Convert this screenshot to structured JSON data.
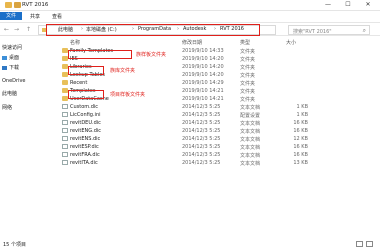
{
  "window": {
    "title": "RVT 2016",
    "minimize": "—",
    "maximize": "☐",
    "close": "✕"
  },
  "ribbon": {
    "tabs": [
      "文件",
      "共享",
      "查看"
    ]
  },
  "nav": {
    "back": "←",
    "forward": "→",
    "up": "↑"
  },
  "breadcrumb": [
    "此电脑",
    "本地磁盘 (C:)",
    "ProgramData",
    "Autodesk",
    "RVT 2016"
  ],
  "search": {
    "placeholder": "搜索\"RVT 2016\""
  },
  "sidebar": [
    "快速访问",
    "桌面",
    "下载",
    "OneDrive",
    "此电脑",
    "网络"
  ],
  "columns": {
    "name": "名称",
    "date": "修改日期",
    "type": "类型",
    "size": "大小"
  },
  "files": [
    {
      "name": "Family Templates",
      "date": "2019/9/10 14:33",
      "type": "文件夹",
      "size": "",
      "kind": "folder"
    },
    {
      "name": "IES",
      "date": "2019/9/10 14:20",
      "type": "文件夹",
      "size": "",
      "kind": "folder"
    },
    {
      "name": "Libraries",
      "date": "2019/9/10 14:20",
      "type": "文件夹",
      "size": "",
      "kind": "folder"
    },
    {
      "name": "Lookup Tables",
      "date": "2019/9/10 14:20",
      "type": "文件夹",
      "size": "",
      "kind": "folder"
    },
    {
      "name": "Recent",
      "date": "2019/9/10 14:29",
      "type": "文件夹",
      "size": "",
      "kind": "folder"
    },
    {
      "name": "Templates",
      "date": "2019/9/10 14:21",
      "type": "文件夹",
      "size": "",
      "kind": "folder"
    },
    {
      "name": "UserDataCache",
      "date": "2019/9/10 14:21",
      "type": "文件夹",
      "size": "",
      "kind": "folder"
    },
    {
      "name": "Custom.dic",
      "date": "2014/12/3 5:25",
      "type": "文本文档",
      "size": "1 KB",
      "kind": "file"
    },
    {
      "name": "LicConfig.ini",
      "date": "2014/12/3 5:25",
      "type": "配置设置",
      "size": "1 KB",
      "kind": "file"
    },
    {
      "name": "revitDEU.dic",
      "date": "2014/12/3 5:25",
      "type": "文本文档",
      "size": "16 KB",
      "kind": "file"
    },
    {
      "name": "revitENG.dic",
      "date": "2014/12/3 5:25",
      "type": "文本文档",
      "size": "16 KB",
      "kind": "file"
    },
    {
      "name": "revitENS.dic",
      "date": "2014/12/3 5:25",
      "type": "文本文档",
      "size": "12 KB",
      "kind": "file"
    },
    {
      "name": "revitESP.dic",
      "date": "2014/12/3 5:25",
      "type": "文本文档",
      "size": "16 KB",
      "kind": "file"
    },
    {
      "name": "revitFRA.dic",
      "date": "2014/12/3 5:25",
      "type": "文本文档",
      "size": "16 KB",
      "kind": "file"
    },
    {
      "name": "revitITA.dic",
      "date": "2014/12/3 5:25",
      "type": "文本文档",
      "size": "13 KB",
      "kind": "file"
    }
  ],
  "annotations": [
    "族样板文件夹",
    "族库文件夹",
    "项目样板文件夹"
  ],
  "status": {
    "count": "15 个项目"
  },
  "colors": {
    "highlight": "#e0201b",
    "folder": "#e8c05a",
    "accent": "#1a6fc9"
  }
}
